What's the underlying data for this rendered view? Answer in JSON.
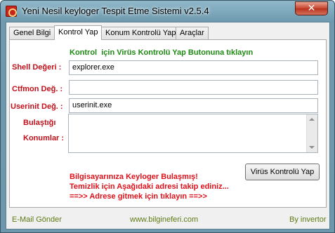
{
  "window": {
    "title": "Yeni Nesil keyloger Tespit Etme Sistemi v2.5.4",
    "close_glyph": "✕"
  },
  "tabs": [
    {
      "label": "Genel Bilgi"
    },
    {
      "label": "Kontrol Yap"
    },
    {
      "label": "Konum Kontrolü Yap"
    },
    {
      "label": "Araçlar"
    }
  ],
  "active_tab": "Kontrol Yap",
  "panel": {
    "info_text": "Kontrol  için Virüs Kontrolü Yap Butonuna tıklayın",
    "fields": {
      "shell": {
        "label": "Shell Değeri :",
        "value": "explorer.exe"
      },
      "ctfmon": {
        "label": "Ctfmon Değ. :",
        "value": ""
      },
      "userinit": {
        "label": "Userinit Değ. :",
        "value": "userinit.exe"
      }
    },
    "infected_label_1": "Bulaştığı",
    "infected_label_2": "Konumlar :",
    "scan_button": "Virüs Kontrolü Yap",
    "warning_line_1": "Bilgisayarınıza Keyloger Bulaşmış!",
    "warning_line_2": "Temizlik için Aşağıdaki adresi takip ediniz...",
    "warning_link": "==>> Adrese gitmek için tıklayın ==>>"
  },
  "statusbar": {
    "email": "E-Mail Gönder",
    "website": "www.bilgineferi.com",
    "author": "By invertor"
  },
  "colors": {
    "label_red": "#c2101a",
    "info_green": "#1e8a14",
    "warning_red": "#e0101a",
    "status_olive": "#5f7a14"
  }
}
